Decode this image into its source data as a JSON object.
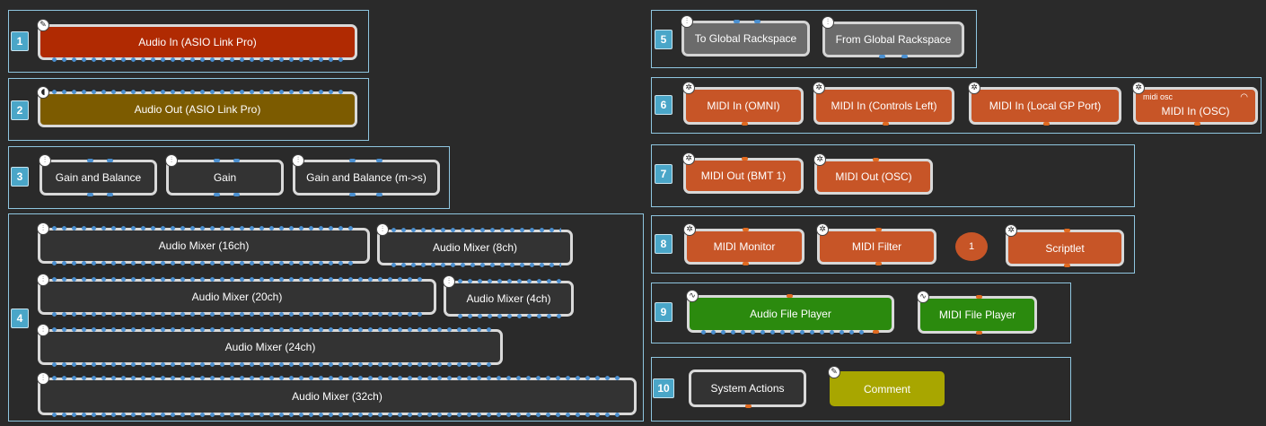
{
  "groups": [
    {
      "num": "1"
    },
    {
      "num": "2"
    },
    {
      "num": "3"
    },
    {
      "num": "4"
    },
    {
      "num": "5"
    },
    {
      "num": "6"
    },
    {
      "num": "7"
    },
    {
      "num": "8"
    },
    {
      "num": "9"
    },
    {
      "num": "10"
    }
  ],
  "blocks": {
    "audio_in": "Audio In (ASIO Link Pro)",
    "audio_out": "Audio Out (ASIO Link Pro)",
    "gain_balance": "Gain and Balance",
    "gain": "Gain",
    "gain_balance_ms": "Gain and Balance (m->s)",
    "mixer_16": "Audio Mixer (16ch)",
    "mixer_8": "Audio Mixer (8ch)",
    "mixer_20": "Audio Mixer (20ch)",
    "mixer_4": "Audio Mixer (4ch)",
    "mixer_24": "Audio Mixer (24ch)",
    "mixer_32": "Audio Mixer (32ch)",
    "to_global": "To Global Rackspace",
    "from_global": "From Global Rackspace",
    "midi_in_omni": "MIDI In (OMNI)",
    "midi_in_controls": "MIDI In (Controls Left)",
    "midi_in_local": "MIDI In (Local GP Port)",
    "midi_in_osc": "MIDI In (OSC)",
    "midi_in_osc_tag": "midi  osc",
    "midi_out_bmt": "MIDI Out (BMT 1)",
    "midi_out_osc": "MIDI Out (OSC)",
    "midi_monitor": "MIDI Monitor",
    "midi_filter": "MIDI Filter",
    "circle_value": "1",
    "scriptlet": "Scriptlet",
    "audio_file_player": "Audio File Player",
    "midi_file_player": "MIDI File Player",
    "system_actions": "System Actions",
    "comment": "Comment"
  },
  "icons": {
    "pencil": "pencil-icon",
    "speaker": "speaker-icon",
    "sliders": "sliders-icon",
    "midi": "midi-port-icon",
    "wave": "waveform-icon",
    "note": "note-icon",
    "wifi": "wifi-icon"
  },
  "colors": {
    "group_border": "#8fc6e0",
    "group_number_bg": "#4aa6c8",
    "audio_in": "#b02a02",
    "audio_out": "#7c5b00",
    "midi": "#c75527",
    "player": "#2b8a0e",
    "comment": "#a8a600",
    "pin_audio": "#4a8fd0",
    "pin_midi": "#e06a20"
  }
}
